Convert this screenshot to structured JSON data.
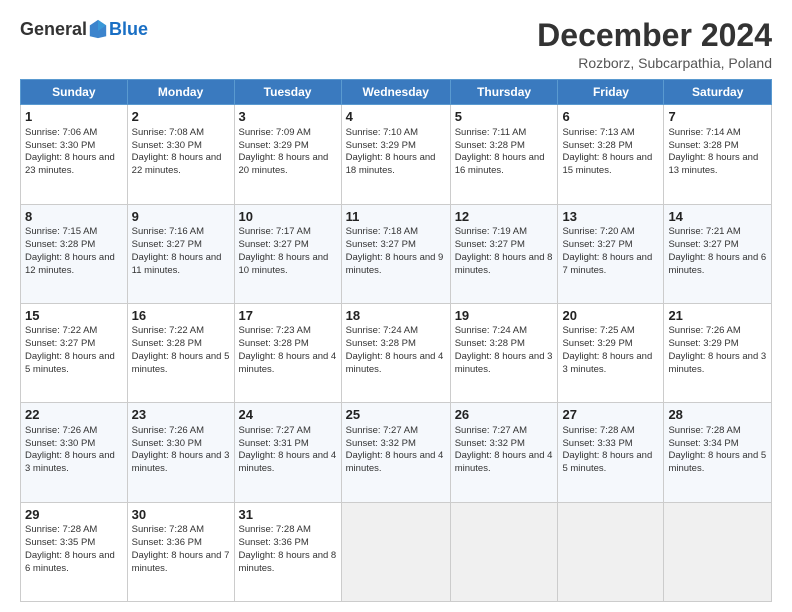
{
  "logo": {
    "general": "General",
    "blue": "Blue"
  },
  "header": {
    "title": "December 2024",
    "subtitle": "Rozborz, Subcarpathia, Poland"
  },
  "weekdays": [
    "Sunday",
    "Monday",
    "Tuesday",
    "Wednesday",
    "Thursday",
    "Friday",
    "Saturday"
  ],
  "weeks": [
    [
      {
        "day": 1,
        "sunrise": "7:06 AM",
        "sunset": "3:30 PM",
        "daylight": "8 hours and 23 minutes."
      },
      {
        "day": 2,
        "sunrise": "7:08 AM",
        "sunset": "3:30 PM",
        "daylight": "8 hours and 22 minutes."
      },
      {
        "day": 3,
        "sunrise": "7:09 AM",
        "sunset": "3:29 PM",
        "daylight": "8 hours and 20 minutes."
      },
      {
        "day": 4,
        "sunrise": "7:10 AM",
        "sunset": "3:29 PM",
        "daylight": "8 hours and 18 minutes."
      },
      {
        "day": 5,
        "sunrise": "7:11 AM",
        "sunset": "3:28 PM",
        "daylight": "8 hours and 16 minutes."
      },
      {
        "day": 6,
        "sunrise": "7:13 AM",
        "sunset": "3:28 PM",
        "daylight": "8 hours and 15 minutes."
      },
      {
        "day": 7,
        "sunrise": "7:14 AM",
        "sunset": "3:28 PM",
        "daylight": "8 hours and 13 minutes."
      }
    ],
    [
      {
        "day": 8,
        "sunrise": "7:15 AM",
        "sunset": "3:28 PM",
        "daylight": "8 hours and 12 minutes."
      },
      {
        "day": 9,
        "sunrise": "7:16 AM",
        "sunset": "3:27 PM",
        "daylight": "8 hours and 11 minutes."
      },
      {
        "day": 10,
        "sunrise": "7:17 AM",
        "sunset": "3:27 PM",
        "daylight": "8 hours and 10 minutes."
      },
      {
        "day": 11,
        "sunrise": "7:18 AM",
        "sunset": "3:27 PM",
        "daylight": "8 hours and 9 minutes."
      },
      {
        "day": 12,
        "sunrise": "7:19 AM",
        "sunset": "3:27 PM",
        "daylight": "8 hours and 8 minutes."
      },
      {
        "day": 13,
        "sunrise": "7:20 AM",
        "sunset": "3:27 PM",
        "daylight": "8 hours and 7 minutes."
      },
      {
        "day": 14,
        "sunrise": "7:21 AM",
        "sunset": "3:27 PM",
        "daylight": "8 hours and 6 minutes."
      }
    ],
    [
      {
        "day": 15,
        "sunrise": "7:22 AM",
        "sunset": "3:27 PM",
        "daylight": "8 hours and 5 minutes."
      },
      {
        "day": 16,
        "sunrise": "7:22 AM",
        "sunset": "3:28 PM",
        "daylight": "8 hours and 5 minutes."
      },
      {
        "day": 17,
        "sunrise": "7:23 AM",
        "sunset": "3:28 PM",
        "daylight": "8 hours and 4 minutes."
      },
      {
        "day": 18,
        "sunrise": "7:24 AM",
        "sunset": "3:28 PM",
        "daylight": "8 hours and 4 minutes."
      },
      {
        "day": 19,
        "sunrise": "7:24 AM",
        "sunset": "3:28 PM",
        "daylight": "8 hours and 3 minutes."
      },
      {
        "day": 20,
        "sunrise": "7:25 AM",
        "sunset": "3:29 PM",
        "daylight": "8 hours and 3 minutes."
      },
      {
        "day": 21,
        "sunrise": "7:26 AM",
        "sunset": "3:29 PM",
        "daylight": "8 hours and 3 minutes."
      }
    ],
    [
      {
        "day": 22,
        "sunrise": "7:26 AM",
        "sunset": "3:30 PM",
        "daylight": "8 hours and 3 minutes."
      },
      {
        "day": 23,
        "sunrise": "7:26 AM",
        "sunset": "3:30 PM",
        "daylight": "8 hours and 3 minutes."
      },
      {
        "day": 24,
        "sunrise": "7:27 AM",
        "sunset": "3:31 PM",
        "daylight": "8 hours and 4 minutes."
      },
      {
        "day": 25,
        "sunrise": "7:27 AM",
        "sunset": "3:32 PM",
        "daylight": "8 hours and 4 minutes."
      },
      {
        "day": 26,
        "sunrise": "7:27 AM",
        "sunset": "3:32 PM",
        "daylight": "8 hours and 4 minutes."
      },
      {
        "day": 27,
        "sunrise": "7:28 AM",
        "sunset": "3:33 PM",
        "daylight": "8 hours and 5 minutes."
      },
      {
        "day": 28,
        "sunrise": "7:28 AM",
        "sunset": "3:34 PM",
        "daylight": "8 hours and 5 minutes."
      }
    ],
    [
      {
        "day": 29,
        "sunrise": "7:28 AM",
        "sunset": "3:35 PM",
        "daylight": "8 hours and 6 minutes."
      },
      {
        "day": 30,
        "sunrise": "7:28 AM",
        "sunset": "3:36 PM",
        "daylight": "8 hours and 7 minutes."
      },
      {
        "day": 31,
        "sunrise": "7:28 AM",
        "sunset": "3:36 PM",
        "daylight": "8 hours and 8 minutes."
      },
      null,
      null,
      null,
      null
    ]
  ]
}
